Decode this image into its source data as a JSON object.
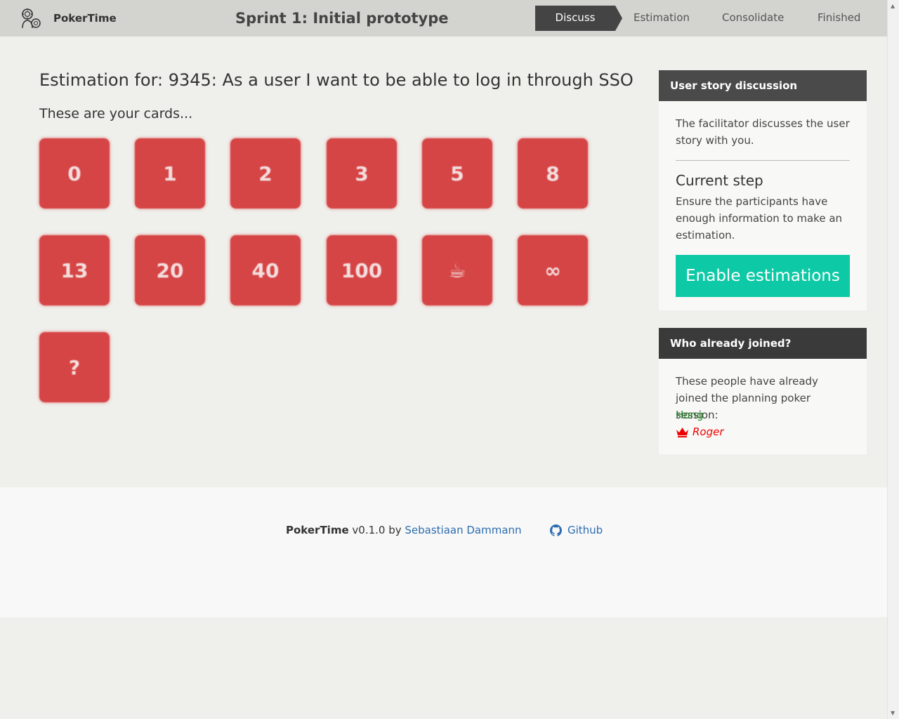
{
  "navbar": {
    "brand": "PokerTime",
    "session_title": "Sprint 1: Initial prototype",
    "steps": [
      "Discuss",
      "Estimation",
      "Consolidate",
      "Finished"
    ],
    "active_step": "Discuss"
  },
  "main": {
    "heading": "Estimation for: 9345: As a user I want to be able to log in through SSO",
    "subheading": "These are your cards...",
    "cards": [
      "0",
      "1",
      "2",
      "3",
      "5",
      "8",
      "13",
      "20",
      "40",
      "100",
      "☕",
      "∞",
      "?"
    ]
  },
  "story_panel": {
    "title": "User story discussion",
    "description": "The facilitator discusses the user story with you.",
    "current_step_title": "Current step",
    "current_step_text": "Ensure the participants have enough information to make an estimation.",
    "button_label": "Enable estimations"
  },
  "joined_panel": {
    "title": "Who already joined?",
    "description": "These people have already joined the planning poker session:",
    "participants": [
      "Hong",
      "Roger"
    ]
  },
  "footer": {
    "app_name": "PokerTime",
    "version_by": " v0.1.0 by ",
    "author": "Sebastiaan Dammann",
    "github_label": "Github"
  },
  "colors": {
    "card": "#d64545",
    "accent_button": "#0ec9a6",
    "facilitator": "#ee0000",
    "participant": "#1b8a1b",
    "link": "#2b6cb0"
  }
}
